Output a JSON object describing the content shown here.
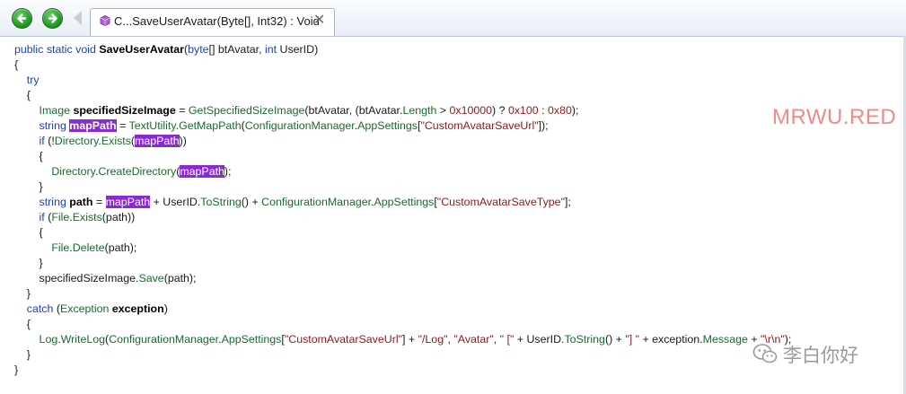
{
  "tab": {
    "title": "C...SaveUserAvatar(Byte[], Int32) : Void",
    "close_label": "✕"
  },
  "watermark": "MRWU.RED",
  "wechat_label": "李白你好",
  "code": [
    [
      [
        "k",
        "public static void "
      ],
      [
        "b",
        "SaveUserAvatar"
      ],
      [
        "p",
        "("
      ],
      [
        "k",
        "byte"
      ],
      [
        "p",
        "[] btAvatar, "
      ],
      [
        "k",
        "int"
      ],
      [
        "p",
        " UserID)"
      ]
    ],
    [
      [
        "p",
        "{"
      ]
    ],
    [
      [
        "p",
        "    "
      ],
      [
        "k",
        "try"
      ]
    ],
    [
      [
        "p",
        "    {"
      ]
    ],
    [
      [
        "p",
        "        "
      ],
      [
        "t",
        "Image "
      ],
      [
        "b",
        "specifiedSizeImage"
      ],
      [
        "p",
        " = "
      ],
      [
        "t",
        "GetSpecifiedSizeImage"
      ],
      [
        "p",
        "(btAvatar, (btAvatar."
      ],
      [
        "t",
        "Length"
      ],
      [
        "p",
        " > "
      ],
      [
        "s",
        "0x10000"
      ],
      [
        "p",
        ") ? "
      ],
      [
        "s",
        "0x100"
      ],
      [
        "p",
        " : "
      ],
      [
        "s",
        "0x80"
      ],
      [
        "p",
        ");"
      ]
    ],
    [
      [
        "p",
        "        "
      ],
      [
        "k",
        "string "
      ],
      [
        "hl",
        "mapPath"
      ],
      [
        "p",
        " = "
      ],
      [
        "t",
        "TextUtility"
      ],
      [
        "p",
        "."
      ],
      [
        "t",
        "GetMapPath"
      ],
      [
        "p",
        "("
      ],
      [
        "t",
        "ConfigurationManager"
      ],
      [
        "p",
        "."
      ],
      [
        "t",
        "AppSettings"
      ],
      [
        "p",
        "["
      ],
      [
        "s",
        "\"CustomAvatarSaveUrl\""
      ],
      [
        "p",
        "]);"
      ]
    ],
    [
      [
        "p",
        "        "
      ],
      [
        "k",
        "if"
      ],
      [
        "p",
        " (!"
      ],
      [
        "t",
        "Directory"
      ],
      [
        "p",
        "."
      ],
      [
        "t",
        "Exists"
      ],
      [
        "p",
        "("
      ],
      [
        "hl2",
        "mapPath"
      ],
      [
        "p",
        "))"
      ]
    ],
    [
      [
        "p",
        "        {"
      ]
    ],
    [
      [
        "p",
        "            "
      ],
      [
        "t",
        "Directory"
      ],
      [
        "p",
        "."
      ],
      [
        "t",
        "CreateDirectory"
      ],
      [
        "p",
        "("
      ],
      [
        "hl2",
        "mapPath"
      ],
      [
        "p",
        ");"
      ]
    ],
    [
      [
        "p",
        "        }"
      ]
    ],
    [
      [
        "p",
        "        "
      ],
      [
        "k",
        "string "
      ],
      [
        "b",
        "path"
      ],
      [
        "p",
        " = "
      ],
      [
        "hl2",
        "mapPath"
      ],
      [
        "p",
        " + UserID."
      ],
      [
        "t",
        "ToString"
      ],
      [
        "p",
        "() + "
      ],
      [
        "t",
        "ConfigurationManager"
      ],
      [
        "p",
        "."
      ],
      [
        "t",
        "AppSettings"
      ],
      [
        "p",
        "["
      ],
      [
        "s",
        "\"CustomAvatarSaveType\""
      ],
      [
        "p",
        "];"
      ]
    ],
    [
      [
        "p",
        "        "
      ],
      [
        "k",
        "if"
      ],
      [
        "p",
        " ("
      ],
      [
        "t",
        "File"
      ],
      [
        "p",
        "."
      ],
      [
        "t",
        "Exists"
      ],
      [
        "p",
        "(path))"
      ]
    ],
    [
      [
        "p",
        "        {"
      ]
    ],
    [
      [
        "p",
        "            "
      ],
      [
        "t",
        "File"
      ],
      [
        "p",
        "."
      ],
      [
        "t",
        "Delete"
      ],
      [
        "p",
        "(path);"
      ]
    ],
    [
      [
        "p",
        "        }"
      ]
    ],
    [
      [
        "p",
        "        specifiedSizeImage."
      ],
      [
        "t",
        "Save"
      ],
      [
        "p",
        "(path);"
      ]
    ],
    [
      [
        "p",
        "    }"
      ]
    ],
    [
      [
        "p",
        "    "
      ],
      [
        "k",
        "catch"
      ],
      [
        "p",
        " ("
      ],
      [
        "t",
        "Exception "
      ],
      [
        "b",
        "exception"
      ],
      [
        "p",
        ")"
      ]
    ],
    [
      [
        "p",
        "    {"
      ]
    ],
    [
      [
        "p",
        "        "
      ],
      [
        "t",
        "Log"
      ],
      [
        "p",
        "."
      ],
      [
        "t",
        "WriteLog"
      ],
      [
        "p",
        "("
      ],
      [
        "t",
        "ConfigurationManager"
      ],
      [
        "p",
        "."
      ],
      [
        "t",
        "AppSettings"
      ],
      [
        "p",
        "["
      ],
      [
        "s",
        "\"CustomAvatarSaveUrl\""
      ],
      [
        "p",
        "] + "
      ],
      [
        "s",
        "\"/Log\""
      ],
      [
        "p",
        ", "
      ],
      [
        "s",
        "\"Avatar\""
      ],
      [
        "p",
        ", "
      ],
      [
        "s",
        "\" [\""
      ],
      [
        "p",
        " + UserID."
      ],
      [
        "t",
        "ToString"
      ],
      [
        "p",
        "() + "
      ],
      [
        "s",
        "\"] \""
      ],
      [
        "p",
        " + exception."
      ],
      [
        "t",
        "Message"
      ],
      [
        "p",
        " + "
      ],
      [
        "s",
        "\"\\r\\n\""
      ],
      [
        "p",
        ");"
      ]
    ],
    [
      [
        "p",
        "    }"
      ]
    ],
    [
      [
        "p",
        "}"
      ]
    ]
  ]
}
